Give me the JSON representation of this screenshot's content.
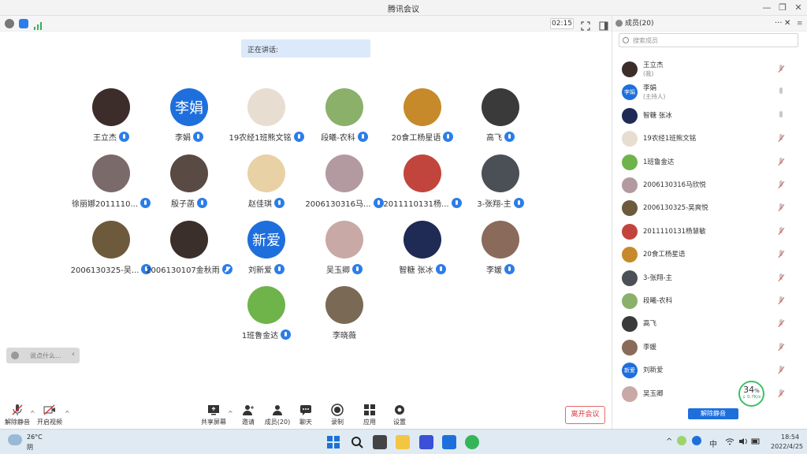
{
  "window": {
    "title": "腾讯会议"
  },
  "meeting": {
    "timer": "02:15",
    "speaking_label": "正在讲话:"
  },
  "participants": [
    {
      "name": "王立杰",
      "mic": "on",
      "avatar_color": "#3d2d2a"
    },
    {
      "name": "李娟",
      "mic": "on",
      "avatar_text": "李娟",
      "avatar_color": "#1e6fdc"
    },
    {
      "name": "19农经1班熊文铭",
      "mic": "on",
      "avatar_color": "#e8ddd1"
    },
    {
      "name": "段曦-农科",
      "mic": "on",
      "avatar_color": "#8ab06a"
    },
    {
      "name": "20食工杨星语",
      "mic": "on",
      "avatar_color": "#c78a2a"
    },
    {
      "name": "高飞",
      "mic": "on",
      "avatar_color": "#3a3a3a"
    },
    {
      "name": "徐丽娜2011110...",
      "mic": "on",
      "avatar_color": "#7a6a6a"
    },
    {
      "name": "殷子菡",
      "mic": "on",
      "avatar_color": "#5a4a44"
    },
    {
      "name": "赵佳琪",
      "mic": "on",
      "avatar_color": "#e9d1a6"
    },
    {
      "name": "2006130316马...",
      "mic": "on",
      "avatar_color": "#b39aa0"
    },
    {
      "name": "2011110131杨...",
      "mic": "on",
      "avatar_color": "#c2453d"
    },
    {
      "name": "3-张翔-主",
      "mic": "on",
      "avatar_color": "#4b4f56"
    },
    {
      "name": "2006130325-吴...",
      "mic": "on",
      "avatar_color": "#6d5a3d"
    },
    {
      "name": "2006130107金秋雨",
      "mic": "off",
      "avatar_color": "#3a2f2a"
    },
    {
      "name": "刘新爱",
      "mic": "on",
      "avatar_text": "新爱",
      "avatar_color": "#1e6fdc"
    },
    {
      "name": "吴玉卿",
      "mic": "on",
      "avatar_color": "#c9a9a6"
    },
    {
      "name": "智糖 张冰",
      "mic": "on",
      "avatar_color": "#1f2a55"
    },
    {
      "name": "李媛",
      "mic": "on",
      "avatar_color": "#8a6a5a"
    },
    {
      "name": "1班鲁金达",
      "mic": "on",
      "avatar_color": "#6fb44a"
    },
    {
      "name": "李晓薇",
      "mic": "none",
      "avatar_color": "#7a6a55"
    }
  ],
  "chat_hint": {
    "placeholder": "说点什么..."
  },
  "controls": {
    "unmute": "解除静音",
    "start_video": "开启视频",
    "share_screen": "共享屏幕",
    "invite": "邀请",
    "members": "成员(20)",
    "chat": "聊天",
    "record": "录制",
    "apps": "应用",
    "settings": "设置",
    "leave": "离开会议"
  },
  "panel": {
    "title": "成员(20)",
    "search_placeholder": "搜索成员",
    "unmute_all": "解除静音",
    "members": [
      {
        "name": "王立杰",
        "sub": "(我)",
        "mic": "off",
        "avatar_color": "#3d2d2a"
      },
      {
        "name": "李娟",
        "sub": "(主持人)",
        "mic": "idle",
        "avatar_text": "李娟",
        "avatar_color": "#1e6fdc"
      },
      {
        "name": "智糖 张冰",
        "sub": "",
        "mic": "idle",
        "avatar_color": "#1f2a55"
      },
      {
        "name": "19农经1班熊文铭",
        "sub": "",
        "mic": "off",
        "avatar_color": "#e8ddd1"
      },
      {
        "name": "1班鲁金达",
        "sub": "",
        "mic": "off",
        "avatar_color": "#6fb44a"
      },
      {
        "name": "2006130316马欣悦",
        "sub": "",
        "mic": "off",
        "avatar_color": "#b39aa0"
      },
      {
        "name": "2006130325-吴爽悦",
        "sub": "",
        "mic": "off",
        "avatar_color": "#6d5a3d"
      },
      {
        "name": "2011110131杨慧敏",
        "sub": "",
        "mic": "off",
        "avatar_color": "#c2453d"
      },
      {
        "name": "20食工杨星语",
        "sub": "",
        "mic": "off",
        "avatar_color": "#c78a2a"
      },
      {
        "name": "3-张翔-主",
        "sub": "",
        "mic": "off",
        "avatar_color": "#4b4f56"
      },
      {
        "name": "段曦-农科",
        "sub": "",
        "mic": "off",
        "avatar_color": "#8ab06a"
      },
      {
        "name": "高飞",
        "sub": "",
        "mic": "off",
        "avatar_color": "#3a3a3a"
      },
      {
        "name": "李媛",
        "sub": "",
        "mic": "off",
        "avatar_color": "#8a6a5a"
      },
      {
        "name": "刘新爱",
        "sub": "",
        "mic": "off",
        "avatar_text": "新爱",
        "avatar_color": "#1e6fdc"
      },
      {
        "name": "吴玉卿",
        "sub": "",
        "mic": "off",
        "avatar_color": "#c9a9a6"
      }
    ]
  },
  "network": {
    "percent": "34",
    "percent_unit": "%",
    "speed": "↓ 0.7K/s"
  },
  "taskbar": {
    "weather_temp": "26°C",
    "weather_desc": "阴",
    "ime": "中",
    "time": "18:54",
    "date": "2022/4/25"
  }
}
